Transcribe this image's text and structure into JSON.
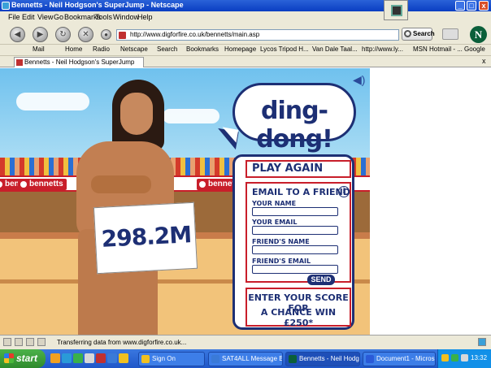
{
  "window": {
    "title": "Bennetts - Neil Hodgson's SuperJump - Netscape",
    "controls": [
      "_",
      "□",
      "x"
    ]
  },
  "menu": [
    "File",
    "Edit",
    "View",
    "Go",
    "Bookmarks",
    "Tools",
    "Window",
    "Help"
  ],
  "nav": {
    "url": "http://www.digforfire.co.uk/bennetts/main.asp",
    "search_label": "Search",
    "logo": "N"
  },
  "personal_toolbar": [
    "Mail",
    "Home",
    "Radio",
    "Netscape",
    "Search",
    "Bookmarks",
    "Homepage",
    "Lycos Tripod H...",
    "Van Dale Taal...",
    "http://www.ly...",
    "MSN Hotmail - ...",
    "Google"
  ],
  "tab": {
    "label": "Bennetts - Neil Hodgson's SuperJump",
    "close": "x"
  },
  "game": {
    "bubble": "ding-dong!",
    "score": "298.2M",
    "banner_text": "bennetts",
    "play_again": "PLAY AGAIN",
    "form_title": "EMAIL TO A FRIEND",
    "info": "i",
    "fields": [
      "YOUR NAME",
      "YOUR EMAIL",
      "FRIEND'S NAME",
      "FRIEND'S EMAIL"
    ],
    "send": "SEND",
    "enter_line1": "ENTER YOUR SCORE FOR",
    "enter_line2": "A CHANCE WIN £250*"
  },
  "status": {
    "text": "Transferring data from www.digforfire.co.uk..."
  },
  "taskbar": {
    "start": "start",
    "tasks": [
      "Sign On",
      "SAT4ALL Message Bo...",
      "Bennetts - Neil Hodgs...",
      "Document1 - Microsof..."
    ],
    "active_task": 2,
    "clock": "13:32"
  }
}
